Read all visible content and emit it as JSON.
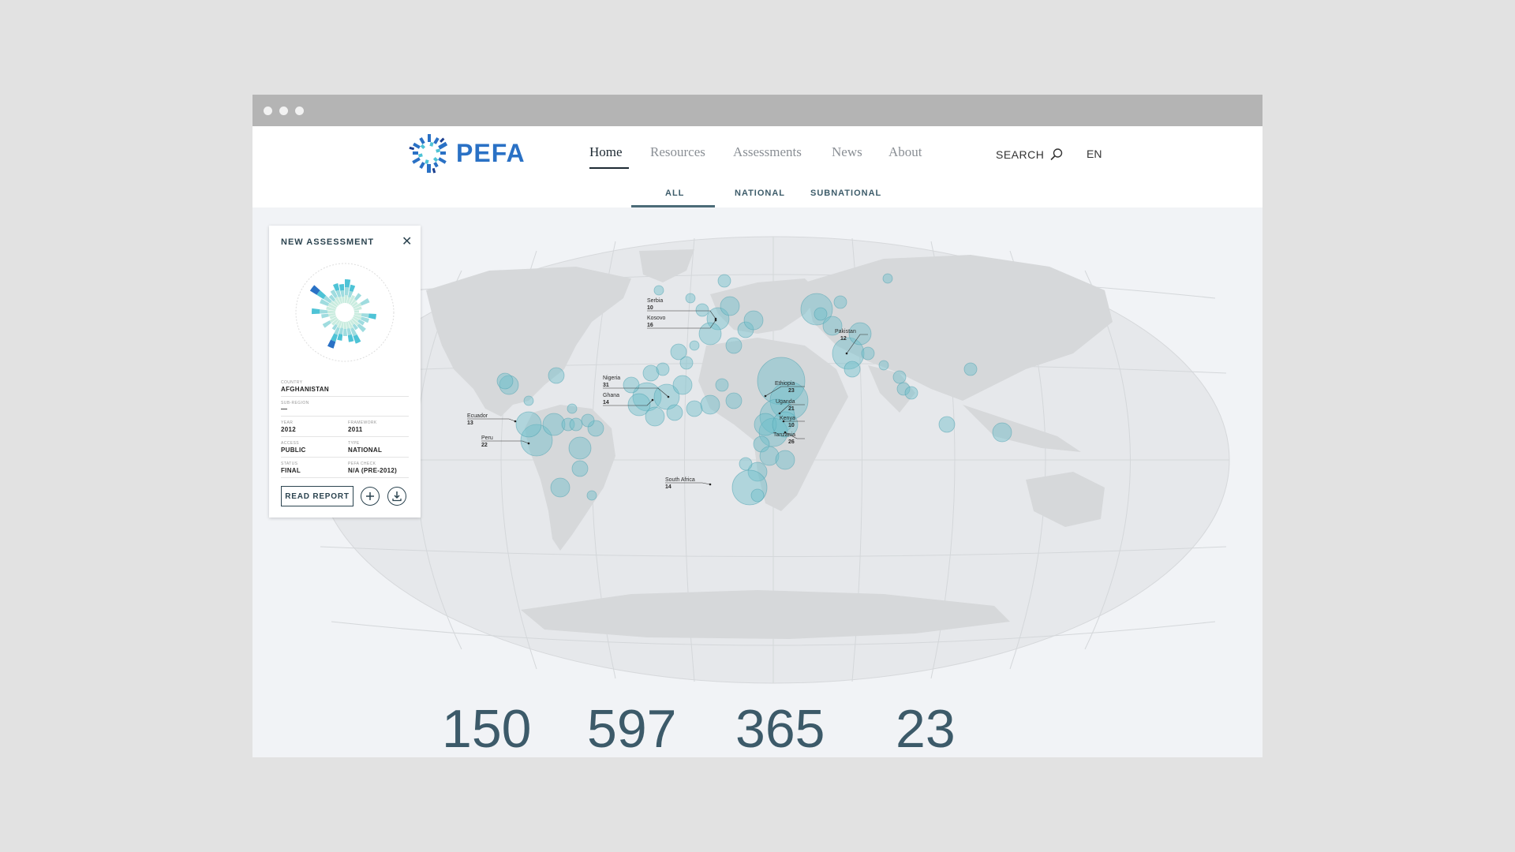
{
  "brand": {
    "name": "PEFA"
  },
  "nav": {
    "items": [
      {
        "label": "Home",
        "active": true
      },
      {
        "label": "Resources"
      },
      {
        "label": "Assessments"
      },
      {
        "label": "News"
      },
      {
        "label": "About"
      }
    ],
    "search_label": "SEARCH",
    "lang": "EN"
  },
  "subnav": {
    "items": [
      {
        "label": "ALL",
        "active": true
      },
      {
        "label": "NATIONAL"
      },
      {
        "label": "SUBNATIONAL"
      }
    ]
  },
  "card": {
    "title": "NEW ASSESSMENT",
    "country_label": "COUNTRY",
    "country": "AFGHANISTAN",
    "subregion_label": "SUB-REGION",
    "subregion": "—",
    "year_label": "YEAR",
    "year": "2012",
    "framework_label": "FRAMEWORK",
    "framework": "2011",
    "access_label": "ACCESS",
    "access": "PUBLIC",
    "type_label": "TYPE",
    "type": "NATIONAL",
    "status_label": "STATUS",
    "status": "FINAL",
    "check_label": "PEFA CHECK",
    "check": "N/A (PRE-2012)",
    "read_report": "READ REPORT"
  },
  "map_labels": [
    {
      "name": "Serbia",
      "value": "10"
    },
    {
      "name": "Kosovo",
      "value": "16"
    },
    {
      "name": "Pakistan",
      "value": "12"
    },
    {
      "name": "Nigeria",
      "value": "31"
    },
    {
      "name": "Ghana",
      "value": "14"
    },
    {
      "name": "Ethiopia",
      "value": "23"
    },
    {
      "name": "Uganda",
      "value": "21"
    },
    {
      "name": "Kenya",
      "value": "10"
    },
    {
      "name": "Tanzania",
      "value": "26"
    },
    {
      "name": "Ecuador",
      "value": "13"
    },
    {
      "name": "Peru",
      "value": "22"
    },
    {
      "name": "South Africa",
      "value": "14"
    }
  ],
  "stats": [
    "150",
    "597",
    "365",
    "23"
  ],
  "colors": {
    "accent": "#2a71c5",
    "bubble": "#7cc6d0",
    "land": "#d6d8da",
    "ocean": "#e6e8eb",
    "text_dark": "#3c5a69"
  }
}
